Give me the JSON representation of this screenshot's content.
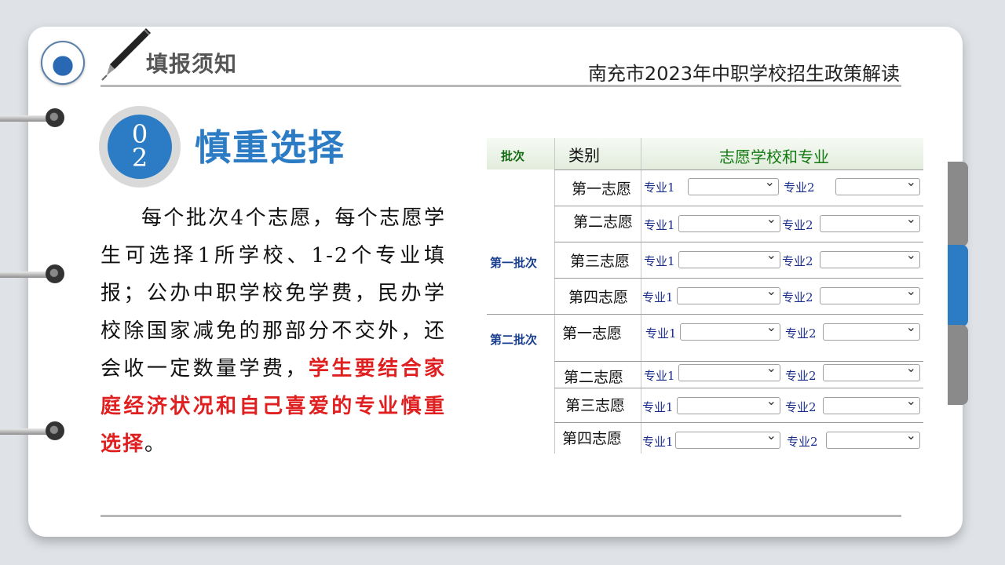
{
  "header": {
    "title": "填报须知",
    "subtitle": "南充市2023年中职学校招生政策解读"
  },
  "section": {
    "number_top": "0",
    "number_bottom": "2",
    "title": "慎重选择"
  },
  "body": {
    "text_normal": "每个批次4个志愿，每个志愿学生可选择1所学校、1-2个专业填报；公办中职学校免学费，民办学校除国家减免的那部分不交外，还会收一定数量学费，",
    "text_highlight": "学生要结合家庭经济状况和自己喜爱的专业慎重选择",
    "text_end": "。"
  },
  "form": {
    "col_batch": "批次",
    "col_category": "类别",
    "col_choice": "志愿学校和专业",
    "batches": [
      {
        "name": "第一批次",
        "rows": [
          {
            "label": "第一志愿",
            "major1": "专业1",
            "major2": "专业2"
          },
          {
            "label": "第二志愿",
            "major1": "专业1",
            "major2": "专业2"
          },
          {
            "label": "第三志愿",
            "major1": "专业1",
            "major2": "专业2"
          },
          {
            "label": "第四志愿",
            "major1": "专业1",
            "major2": "专业2"
          }
        ]
      },
      {
        "name": "第二批次",
        "rows": [
          {
            "label": "第一志愿",
            "major1": "专业1",
            "major2": "专业2"
          },
          {
            "label": "第二志愿",
            "major1": "专业1",
            "major2": "专业2"
          },
          {
            "label": "第三志愿",
            "major1": "专业1",
            "major2": "专业2"
          },
          {
            "label": "第四志愿",
            "major1": "专业1",
            "major2": "专业2"
          }
        ]
      }
    ]
  },
  "colors": {
    "accent": "#2b7cc4",
    "highlight": "#e02020",
    "tab_gray": "#8a8a8a",
    "tab_blue": "#2b7cc4"
  }
}
